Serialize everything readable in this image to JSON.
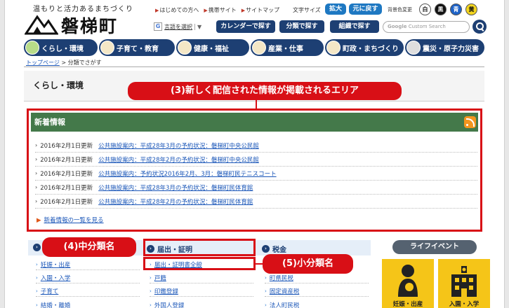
{
  "header": {
    "tagline": "温もりと活力あるまちづくり",
    "site_name": "磐梯町",
    "top_links": [
      "はじめての方へ",
      "携帯サイト",
      "サイトマップ"
    ],
    "font_size_label": "文字サイズ",
    "font_enlarge": "拡大",
    "font_reset": "元に戻す",
    "bg_color_label": "背景色変更",
    "bg_colors": [
      "白",
      "黒",
      "青",
      "黄"
    ],
    "language_badge": "G",
    "language_select": "言語を選択",
    "language_arrow": "▼",
    "search_buttons": [
      "カレンダーで探す",
      "分類で探す",
      "組織で探す"
    ],
    "search_google": "Google",
    "search_placeholder": "Custom Search"
  },
  "nav": {
    "items": [
      "くらし・環境",
      "子育て・教育",
      "健康・福祉",
      "産業・仕事",
      "町政・まちづくり",
      "震災・原子力災害"
    ]
  },
  "breadcrumb": {
    "home": "トップページ",
    "separator": " > ",
    "current": "分類でさがす"
  },
  "page": {
    "title": "くらし・環境"
  },
  "news": {
    "heading": "新着情報",
    "items": [
      {
        "date": "2016年2月1日更新",
        "title": "公共施設案内：平成28年3月の予約状況：磐梯町中央公民館"
      },
      {
        "date": "2016年2月1日更新",
        "title": "公共施設案内：平成28年2月の予約状況：磐梯町中央公民館"
      },
      {
        "date": "2016年2月1日更新",
        "title": "公共施設案内：予約状況2016年2月、3月：磐梯町民テニスコート"
      },
      {
        "date": "2016年2月1日更新",
        "title": "公共施設案内：平成28年3月の予約状況：磐梯町民体育館"
      },
      {
        "date": "2016年2月1日更新",
        "title": "公共施設案内：平成28年2月の予約状況：磐梯町民体育館"
      }
    ],
    "more": "新着情報の一覧を見る"
  },
  "callouts": {
    "area": "(3)新しく配信された情報が掲載されるエリア",
    "middle": "(4)中分類名",
    "small": "(5)小分類名"
  },
  "categories": {
    "col1": {
      "heading": "",
      "items": [
        "妊娠・出産",
        "入園・入学",
        "子育て",
        "結婚・離婚"
      ]
    },
    "col2": {
      "heading": "届出・証明",
      "items": [
        "届出・証明書全般",
        "戸籍",
        "印鑑登録",
        "外国人登録"
      ]
    },
    "col3": {
      "heading": "税金",
      "items": [
        "",
        "町県民税",
        "固定資産税",
        "法人町民税"
      ]
    }
  },
  "life_event": {
    "button": "ライフイベント",
    "cards": [
      "妊娠・出産",
      "入園・入学"
    ]
  },
  "colors": {
    "navy": "#1d3f73",
    "accent_red": "#d80f16",
    "news_green": "#44794a",
    "life_yellow": "#f5c518"
  }
}
